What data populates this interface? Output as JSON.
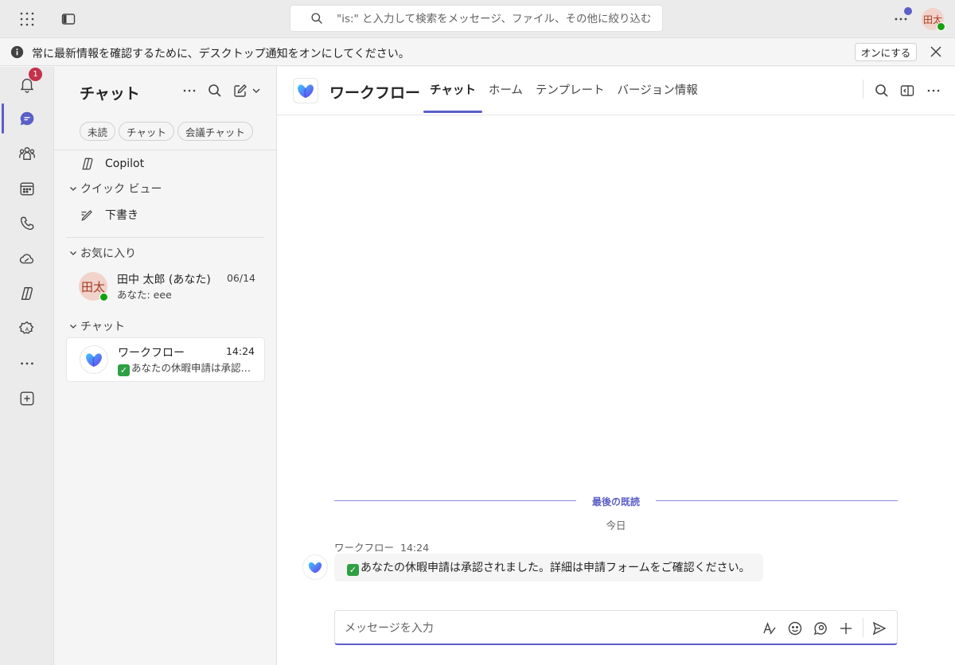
{
  "topbar": {
    "search_placeholder": "\"is:\" と入力して検索をメッセージ、ファイル、その他に絞り込む",
    "avatar_initials": "田太",
    "icons": [
      "app-launcher-icon",
      "sidebar-toggle-icon",
      "search-icon",
      "more-icon"
    ]
  },
  "banner": {
    "text": "常に最新情報を確認するために、デスクトップ通知をオンにしてください。",
    "button_label": "オンにする"
  },
  "rail": {
    "activity_badge": "1",
    "items": [
      "activity",
      "chat",
      "teams",
      "calendar",
      "calls",
      "onedrive",
      "copilot",
      "apps",
      "more",
      "add"
    ]
  },
  "chat_list": {
    "title": "チャット",
    "filters": [
      "未読",
      "チャット",
      "会議チャット"
    ],
    "copilot_label": "Copilot",
    "quick_view_label": "クイック ビュー",
    "drafts_label": "下書き",
    "favorites_label": "お気に入り",
    "chats_label": "チャット",
    "favorites": [
      {
        "avatar": "田太",
        "name": "田中 太郎 (あなた)",
        "preview": "あなた: eee",
        "time": "06/14"
      }
    ],
    "chats": [
      {
        "name": "ワークフロー",
        "preview": "あなたの休暇申請は承認されました。詳細は申請フォームをご確認ください。",
        "time": "14:24"
      }
    ]
  },
  "main": {
    "title": "ワークフロー",
    "tabs": [
      "チャット",
      "ホーム",
      "テンプレート",
      "バージョン情報"
    ],
    "active_tab": 0,
    "last_read_label": "最後の既読",
    "today_label": "今日",
    "message": {
      "sender": "ワークフロー",
      "time": "14:24",
      "text": "あなたの休暇申請は承認されました。詳細は申請フォームをご確認ください。"
    },
    "composer_placeholder": "メッセージを入力"
  },
  "colors": {
    "accent": "#5b5fc7",
    "badge": "#c4314b",
    "presence": "#13a10e"
  }
}
